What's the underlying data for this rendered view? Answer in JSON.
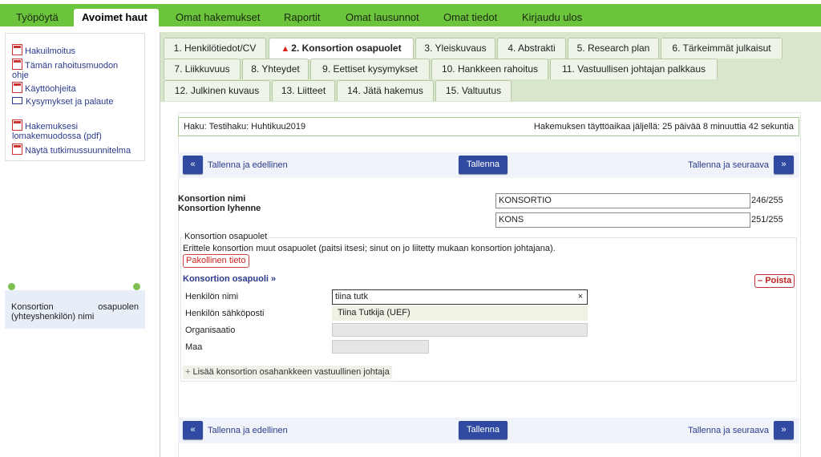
{
  "top_nav": [
    {
      "label": "Työpöytä"
    },
    {
      "label": "Avoimet haut",
      "active": true
    },
    {
      "label": "Omat hakemukset"
    },
    {
      "label": "Raportit"
    },
    {
      "label": "Omat lausunnot"
    },
    {
      "label": "Omat tiedot"
    },
    {
      "label": "Kirjaudu ulos"
    }
  ],
  "sidebar": {
    "links": [
      {
        "label": "Hakuilmoitus",
        "icon": "pdf-icon"
      },
      {
        "label": "Tämän rahoitusmuodon ohje",
        "icon": "pdf-icon"
      },
      {
        "label": "Käyttöohjeita",
        "icon": "pdf-icon"
      },
      {
        "label": "Kysymykset ja palaute",
        "icon": "mail-icon"
      },
      {
        "label": "Hakemuksesi lomakemuodossa (pdf)",
        "icon": "pdf-icon"
      },
      {
        "label": "Näytä tutkimussuunnitelma",
        "icon": "pdf-icon"
      }
    ],
    "help_note": "Konsortion osapuolen (yhteyshenkilön) nimi"
  },
  "tabs": [
    {
      "label": "1. Henkilötiedot/CV"
    },
    {
      "label": "2. Konsortion osapuolet",
      "active": true,
      "warning": true
    },
    {
      "label": "3. Yleiskuvaus"
    },
    {
      "label": "4. Abstrakti"
    },
    {
      "label": "5. Research plan"
    },
    {
      "label": "6. Tärkeimmät julkaisut"
    },
    {
      "label": "7. Liikkuvuus"
    },
    {
      "label": "8. Yhteydet"
    },
    {
      "label": "9. Eettiset kysymykset"
    },
    {
      "label": "10. Hankkeen rahoitus"
    },
    {
      "label": "11. Vastuullisen johtajan palkkaus"
    },
    {
      "label": "12. Julkinen kuvaus"
    },
    {
      "label": "13. Liitteet"
    },
    {
      "label": "14. Jätä hakemus"
    },
    {
      "label": "15. Valtuutus"
    }
  ],
  "haku": {
    "call": "Haku: Testihaku: Huhtikuu2019",
    "time_left": "Hakemuksen täyttöaikaa jäljellä: 25 päivää 8 minuuttia 42 sekuntia"
  },
  "actions": {
    "prev": "Tallenna ja edellinen",
    "save": "Tallenna",
    "next": "Tallenna ja seuraava",
    "prev_icon": "«",
    "next_icon": "»"
  },
  "form": {
    "name_label": "Konsortion nimi",
    "name_value": "KONSORTIO",
    "name_count": "246/255",
    "abbr_label": "Konsortion lyhenne",
    "abbr_value": "KONS",
    "abbr_count": "251/255",
    "parties": {
      "legend": "Konsortion osapuolet",
      "description": "Erittele konsortion muut osapuolet (paitsi itsesi; sinut on jo liitetty mukaan konsortion johtajana).",
      "required": "Pakollinen tieto",
      "party_title": "Konsortion osapuoli »",
      "remove": "Poista",
      "person_name_label": "Henkilön nimi",
      "person_name_value": "tiina tutk",
      "clear": "×",
      "suggestion": "Tiina Tutkija (UEF)",
      "email_label": "Henkilön sähköposti",
      "org_label": "Organisaatio",
      "country_label": "Maa",
      "add_link": "Lisää konsortion osahankkeen vastuullinen johtaja"
    }
  }
}
